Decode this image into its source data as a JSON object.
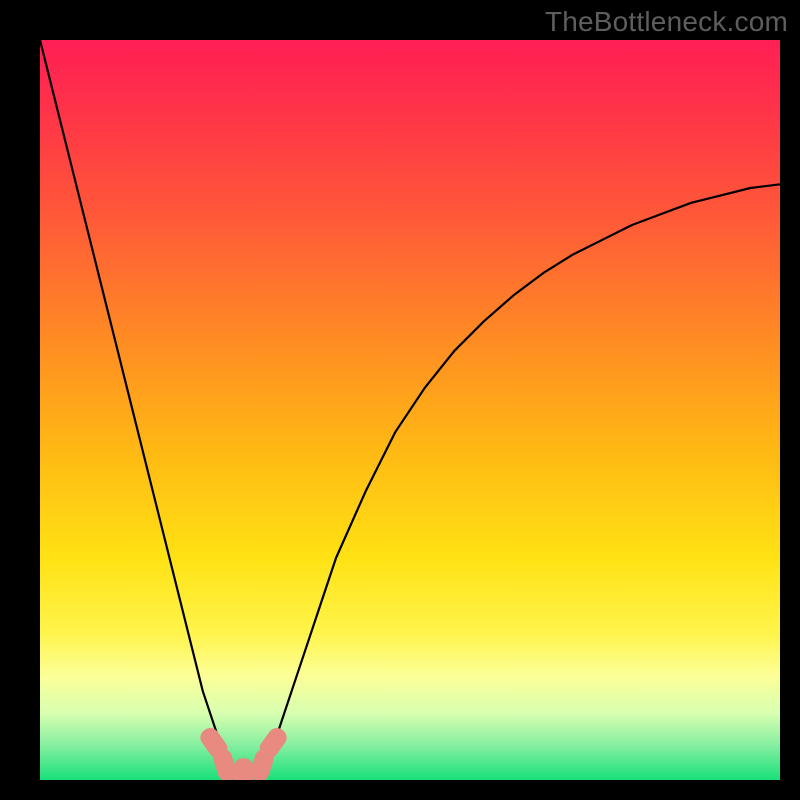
{
  "watermark": "TheBottleneck.com",
  "colors": {
    "frame": "#000000",
    "gradient_stops": [
      {
        "offset": 0.0,
        "color": "#ff1f55"
      },
      {
        "offset": 0.1,
        "color": "#ff3448"
      },
      {
        "offset": 0.25,
        "color": "#ff5c37"
      },
      {
        "offset": 0.4,
        "color": "#ff8a24"
      },
      {
        "offset": 0.55,
        "color": "#ffb714"
      },
      {
        "offset": 0.7,
        "color": "#ffe214"
      },
      {
        "offset": 0.8,
        "color": "#fff44a"
      },
      {
        "offset": 0.86,
        "color": "#fcff98"
      },
      {
        "offset": 0.91,
        "color": "#d8ffb0"
      },
      {
        "offset": 0.95,
        "color": "#8cf0a2"
      },
      {
        "offset": 1.0,
        "color": "#19e07a"
      }
    ],
    "curve": "#000000",
    "marker": "#e98a81"
  },
  "chart_data": {
    "type": "line",
    "title": "",
    "xlabel": "",
    "ylabel": "",
    "xlim": [
      0,
      100
    ],
    "ylim": [
      0,
      100
    ],
    "x": [
      0,
      2,
      4,
      6,
      8,
      10,
      12,
      14,
      16,
      18,
      20,
      22,
      24,
      25,
      26,
      27,
      28,
      29,
      30,
      31,
      32,
      34,
      36,
      38,
      40,
      44,
      48,
      52,
      56,
      60,
      64,
      68,
      72,
      76,
      80,
      84,
      88,
      92,
      96,
      100
    ],
    "values": [
      100,
      92,
      84,
      76,
      68,
      60,
      52,
      44,
      36,
      28,
      20,
      12,
      6,
      3,
      1.2,
      0.6,
      0.4,
      0.6,
      1.2,
      3,
      6,
      12,
      18,
      24,
      30,
      39,
      47,
      53,
      58,
      62,
      65.5,
      68.5,
      71,
      73,
      75,
      76.5,
      78,
      79,
      80,
      80.5
    ],
    "markers": [
      {
        "x": 23.5,
        "y": 5.0
      },
      {
        "x": 25.0,
        "y": 2.0
      },
      {
        "x": 27.5,
        "y": 0.8
      },
      {
        "x": 30.0,
        "y": 2.0
      },
      {
        "x": 31.5,
        "y": 5.0
      }
    ]
  }
}
